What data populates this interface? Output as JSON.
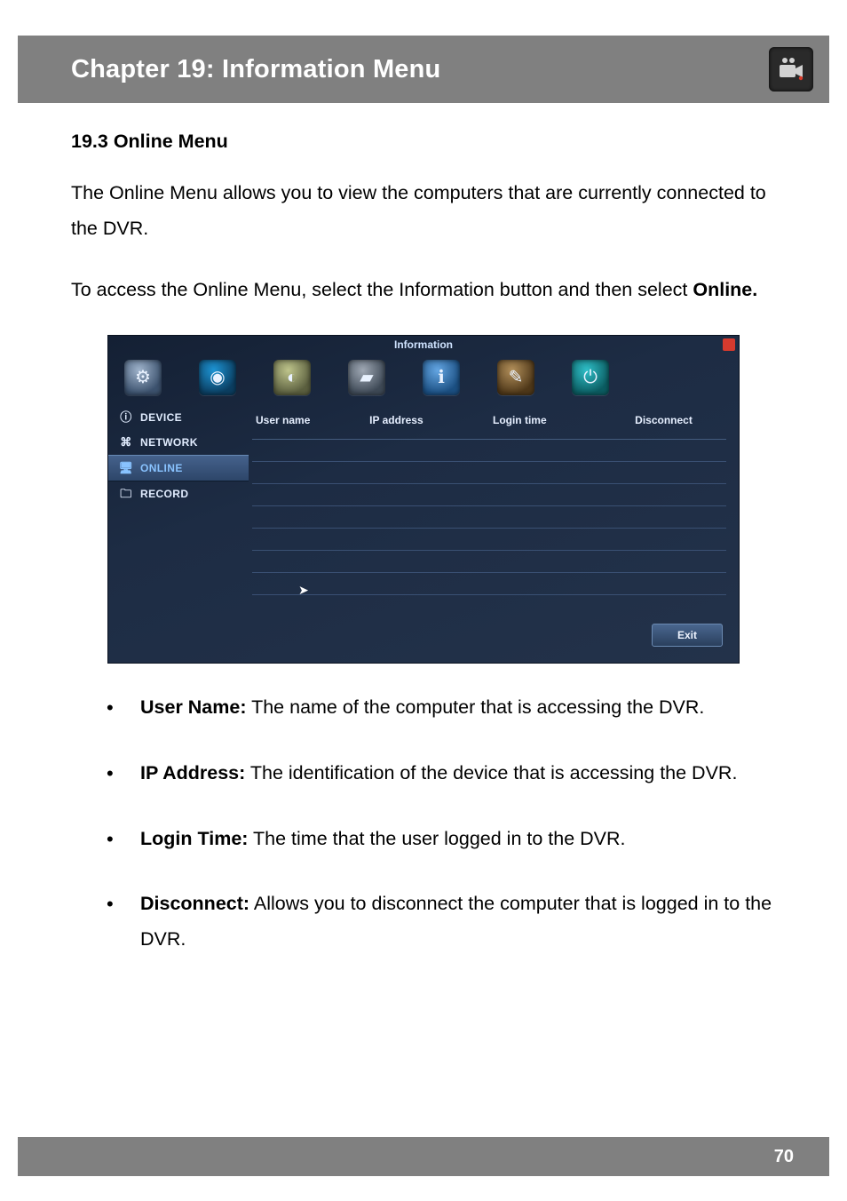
{
  "header": {
    "title": "Chapter 19: Information Menu",
    "icon_name": "camera-record-icon"
  },
  "section": {
    "heading": "19.3 Online Menu",
    "intro": "The Online Menu allows you to view the computers that are currently connected to the DVR.",
    "access_pre": "To access the Online Menu, select the Information button and then select ",
    "access_bold": "Online."
  },
  "screenshot": {
    "window_title": "Information",
    "toolbar_icons": [
      {
        "name": "settings-gear-icon"
      },
      {
        "name": "camera-eye-icon"
      },
      {
        "name": "ptz-pan-icon"
      },
      {
        "name": "storage-disk-icon"
      },
      {
        "name": "information-icon"
      },
      {
        "name": "maintenance-brush-icon"
      },
      {
        "name": "power-icon"
      }
    ],
    "sidebar": [
      {
        "icon": "info-badge-icon",
        "label": "DEVICE",
        "active": false
      },
      {
        "icon": "network-nodes-icon",
        "label": "NETWORK",
        "active": false
      },
      {
        "icon": "monitor-online-icon",
        "label": "ONLINE",
        "active": true
      },
      {
        "icon": "record-folder-icon",
        "label": "RECORD",
        "active": false
      }
    ],
    "columns": {
      "user_name": "User name",
      "ip_address": "IP address",
      "login_time": "Login time",
      "disconnect": "Disconnect"
    },
    "empty_rows": 7,
    "exit_label": "Exit"
  },
  "bullets": [
    {
      "title": "User Name:",
      "text": " The name of the computer that is accessing the DVR."
    },
    {
      "title": "IP Address:",
      "text": " The identification of the device that is accessing the DVR."
    },
    {
      "title": "Login Time:",
      "text": " The time that the user logged in to the DVR."
    },
    {
      "title": "Disconnect:",
      "text": " Allows you to disconnect the computer that is logged in to the DVR."
    }
  ],
  "footer": {
    "page_number": "70"
  }
}
